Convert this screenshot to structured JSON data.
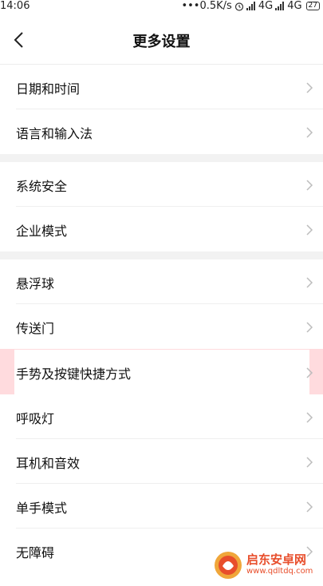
{
  "status_bar": {
    "time": "14:06",
    "network_speed": "•••0.5K/s",
    "network1": "4G",
    "network2": "4G",
    "battery": "27"
  },
  "header": {
    "title": "更多设置"
  },
  "settings": {
    "items": [
      {
        "label": "日期和时间"
      },
      {
        "label": "语言和输入法"
      },
      {
        "label": "系统安全"
      },
      {
        "label": "企业模式"
      },
      {
        "label": "悬浮球"
      },
      {
        "label": "传送门"
      },
      {
        "label": "手势及按键快捷方式"
      },
      {
        "label": "呼吸灯"
      },
      {
        "label": "耳机和音效"
      },
      {
        "label": "单手模式"
      },
      {
        "label": "无障碍"
      }
    ]
  },
  "watermark": {
    "name": "启东安卓网",
    "url": "www.qdltdq.com"
  },
  "colors": {
    "highlight": "#ffbec3",
    "watermark": "#e84e2b",
    "group_gap": "#f2f2f2"
  }
}
